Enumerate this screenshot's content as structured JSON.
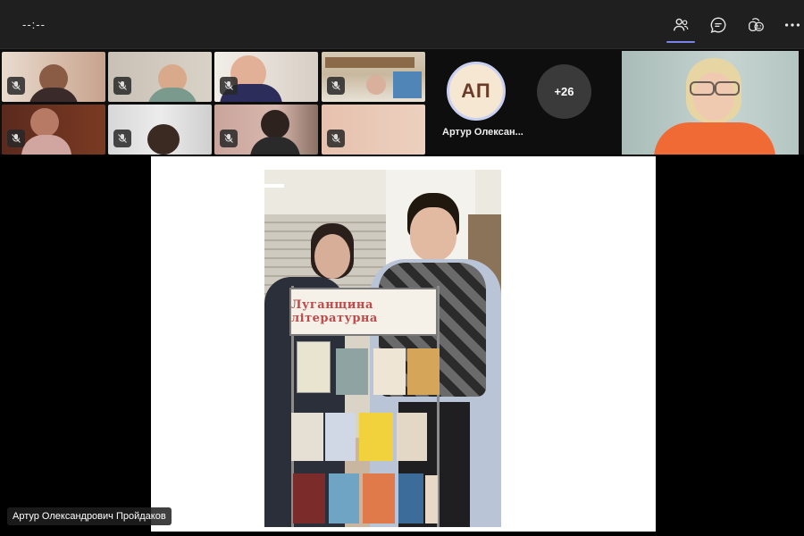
{
  "topbar": {
    "timer": "--:--",
    "buttons": [
      {
        "name": "participants",
        "icon": "people-icon",
        "active": true
      },
      {
        "name": "chat",
        "icon": "chat-icon",
        "active": false
      },
      {
        "name": "reactions",
        "icon": "reactions-icon",
        "active": false
      },
      {
        "name": "more",
        "icon": "more-icon",
        "active": false
      }
    ]
  },
  "avatar": {
    "initials": "АП",
    "name": "Артур Олексан..."
  },
  "overflow_count": "+26",
  "stage": {
    "shelf_sign": "Луганщина літературна"
  },
  "active_speaker_label": "Артур Олександрович Пройдаков"
}
